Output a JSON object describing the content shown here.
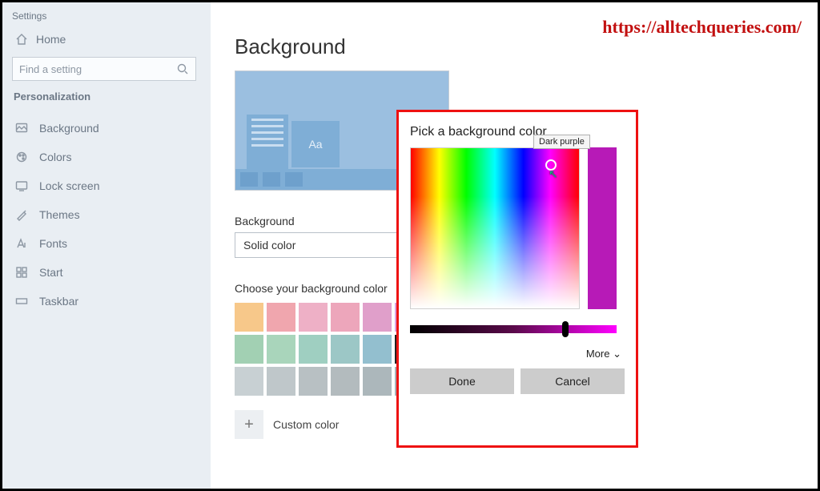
{
  "watermark": "https://alltechqueries.com/",
  "sidebar": {
    "title": "Settings",
    "home": "Home",
    "search_placeholder": "Find a setting",
    "section": "Personalization",
    "items": [
      {
        "icon": "background-icon",
        "label": "Background"
      },
      {
        "icon": "colors-icon",
        "label": "Colors"
      },
      {
        "icon": "lockscreen-icon",
        "label": "Lock screen"
      },
      {
        "icon": "themes-icon",
        "label": "Themes"
      },
      {
        "icon": "fonts-icon",
        "label": "Fonts"
      },
      {
        "icon": "start-icon",
        "label": "Start"
      },
      {
        "icon": "taskbar-icon",
        "label": "Taskbar"
      }
    ]
  },
  "main": {
    "title": "Background",
    "preview_sample_text": "Aa",
    "bg_label": "Background",
    "bg_value": "Solid color",
    "choose_label": "Choose your background color",
    "swatches": [
      "#f7c88a",
      "#f0a6ae",
      "#eeb0c6",
      "#eda6bb",
      "#e09fca",
      "#d9a3e0",
      "#a2d0b3",
      "#a9d5bb",
      "#9fcfc1",
      "#9cc7c6",
      "#93bfcf",
      "#8fb8da",
      "#c8d0d3",
      "#bfc7ca",
      "#b8c0c3",
      "#b3bbbe",
      "#acb7bb",
      "#a6b4b9"
    ],
    "selected_swatch_index": 11,
    "custom_label": "Custom color",
    "custom_glyph": "+"
  },
  "picker": {
    "title": "Pick a background color",
    "tooltip": "Dark purple",
    "current_color": "#b71ab7",
    "more_label": "More",
    "more_glyph": "⌄",
    "done": "Done",
    "cancel": "Cancel"
  }
}
